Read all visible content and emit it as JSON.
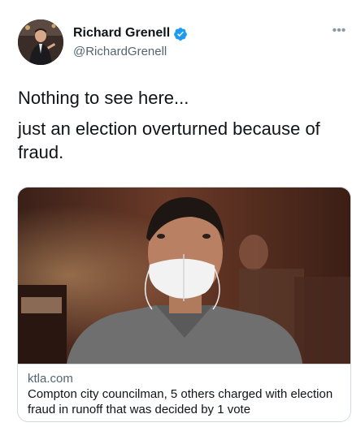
{
  "tweet": {
    "author": {
      "name": "Richard Grenell",
      "handle": "@RichardGrenell",
      "verified": true
    },
    "more_label": "•••",
    "text_lines": [
      "Nothing to see here...",
      "just an election overturned because of fraud."
    ],
    "card": {
      "domain": "ktla.com",
      "title": "Compton city councilman, 5 others charged with election fraud in runoff that was decided by 1 vote"
    }
  },
  "colors": {
    "text_primary": "#0f1419",
    "text_secondary": "#536471",
    "verified_blue": "#1d9bf0",
    "border": "#cfd9de"
  }
}
